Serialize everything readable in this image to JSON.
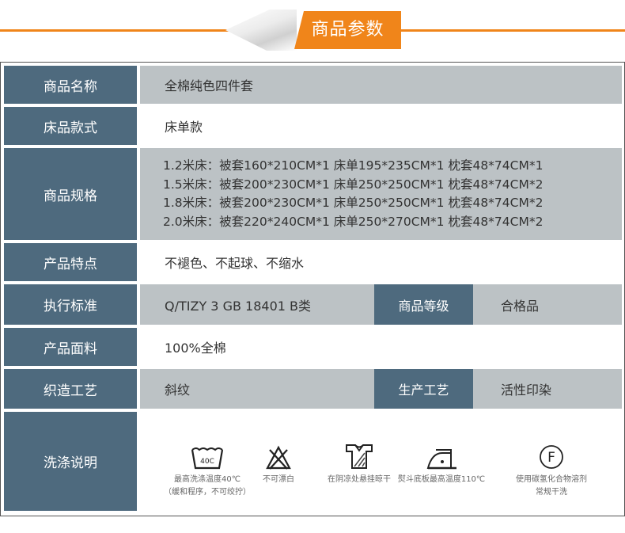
{
  "header": {
    "title": "商品参数"
  },
  "rows": {
    "name": {
      "label": "商品名称",
      "value": "全棉纯色四件套"
    },
    "style": {
      "label": "床品款式",
      "value": "床单款"
    },
    "spec": {
      "label": "商品规格",
      "lines": [
        "1.2米床：被套160*210CM*1  床单195*235CM*1  枕套48*74CM*1",
        "1.5米床：被套200*230CM*1  床单250*250CM*1  枕套48*74CM*2",
        "1.8米床：被套200*230CM*1  床单250*250CM*1  枕套48*74CM*2",
        "2.0米床：被套220*240CM*1  床单250*270CM*1  枕套48*74CM*2"
      ]
    },
    "feature": {
      "label": "产品特点",
      "value": "不褪色、不起球、不缩水"
    },
    "standard": {
      "label": "执行标准",
      "value": "Q/TIZY 3 GB 18401 B类",
      "label2": "商品等级",
      "value2": "合格品"
    },
    "fabric": {
      "label": "产品面料",
      "value": "100%全棉"
    },
    "weave": {
      "label": "织造工艺",
      "value": "斜纹",
      "label2": "生产工艺",
      "value2": "活性印染"
    },
    "wash": {
      "label": "洗涤说明"
    }
  },
  "care": [
    {
      "icon": "wash-40-icon",
      "badge": "40C",
      "line1": "最高洗涤温度40℃",
      "line2": "（缓和程序，不可绞拧）"
    },
    {
      "icon": "no-bleach-icon",
      "line1": "不可漂白",
      "line2": ""
    },
    {
      "icon": "shade-dry-icon",
      "line1": "在阴凉处悬挂晾干",
      "line2": ""
    },
    {
      "icon": "iron-110-icon",
      "line1": "熨斗底板最高温度110℃",
      "line2": ""
    },
    {
      "icon": "dry-clean-f-icon",
      "badge": "F",
      "line1": "使用碳氢化合物溶剂",
      "line2": "常规干洗"
    }
  ],
  "colors": {
    "accent": "#f0851a",
    "label_bg": "#4e6a7e",
    "value_bg": "#bcc2c5"
  }
}
